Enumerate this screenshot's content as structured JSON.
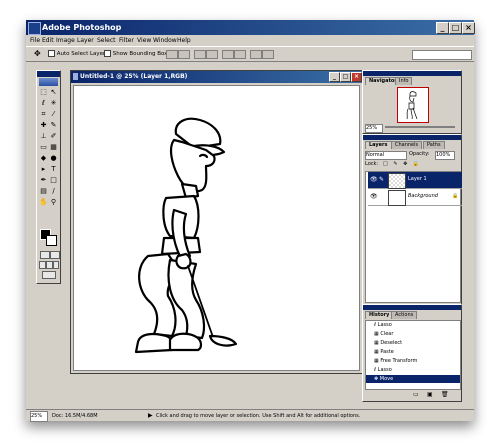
{
  "app": {
    "title": "Adobe Photoshop",
    "minimize_glyph": "_",
    "maximize_glyph": "□",
    "close_glyph": "×"
  },
  "menu": [
    "File",
    "Edit",
    "Image",
    "Layer",
    "Select",
    "Filter",
    "View",
    "Window",
    "Help"
  ],
  "options_bar": {
    "tool_icon": "move-tool-icon",
    "auto_select_label": "Auto Select Layer",
    "bounding_box_label": "Show Bounding Box"
  },
  "document": {
    "title": "Untitled-1 @ 25% (Layer 1,RGB)"
  },
  "navigator": {
    "tabs": [
      "Navigator",
      "Info"
    ],
    "zoom": "25%"
  },
  "layers": {
    "tabs": [
      "Layers",
      "Channels",
      "Paths"
    ],
    "blend_mode": "Normal",
    "opacity_label": "Opacity:",
    "opacity_value": "100%",
    "lock_label": "Lock:",
    "items": [
      {
        "name": "Layer 1"
      },
      {
        "name": "Background"
      }
    ]
  },
  "history": {
    "tabs": [
      "History",
      "Actions"
    ],
    "items": [
      "Lasso",
      "Clear",
      "Deselect",
      "Paste",
      "Free Transform",
      "Lasso",
      "Move"
    ],
    "selected_index": 6
  },
  "status": {
    "zoom": "25%",
    "doc_size": "Doc: 16.5M/4.68M",
    "hint": "Click and drag to move layer or selection. Use Shift and Alt for additional options."
  },
  "colors": {
    "titlebar": "#0a246a",
    "chrome": "#d4d0c8",
    "selection": "#0a246a"
  }
}
